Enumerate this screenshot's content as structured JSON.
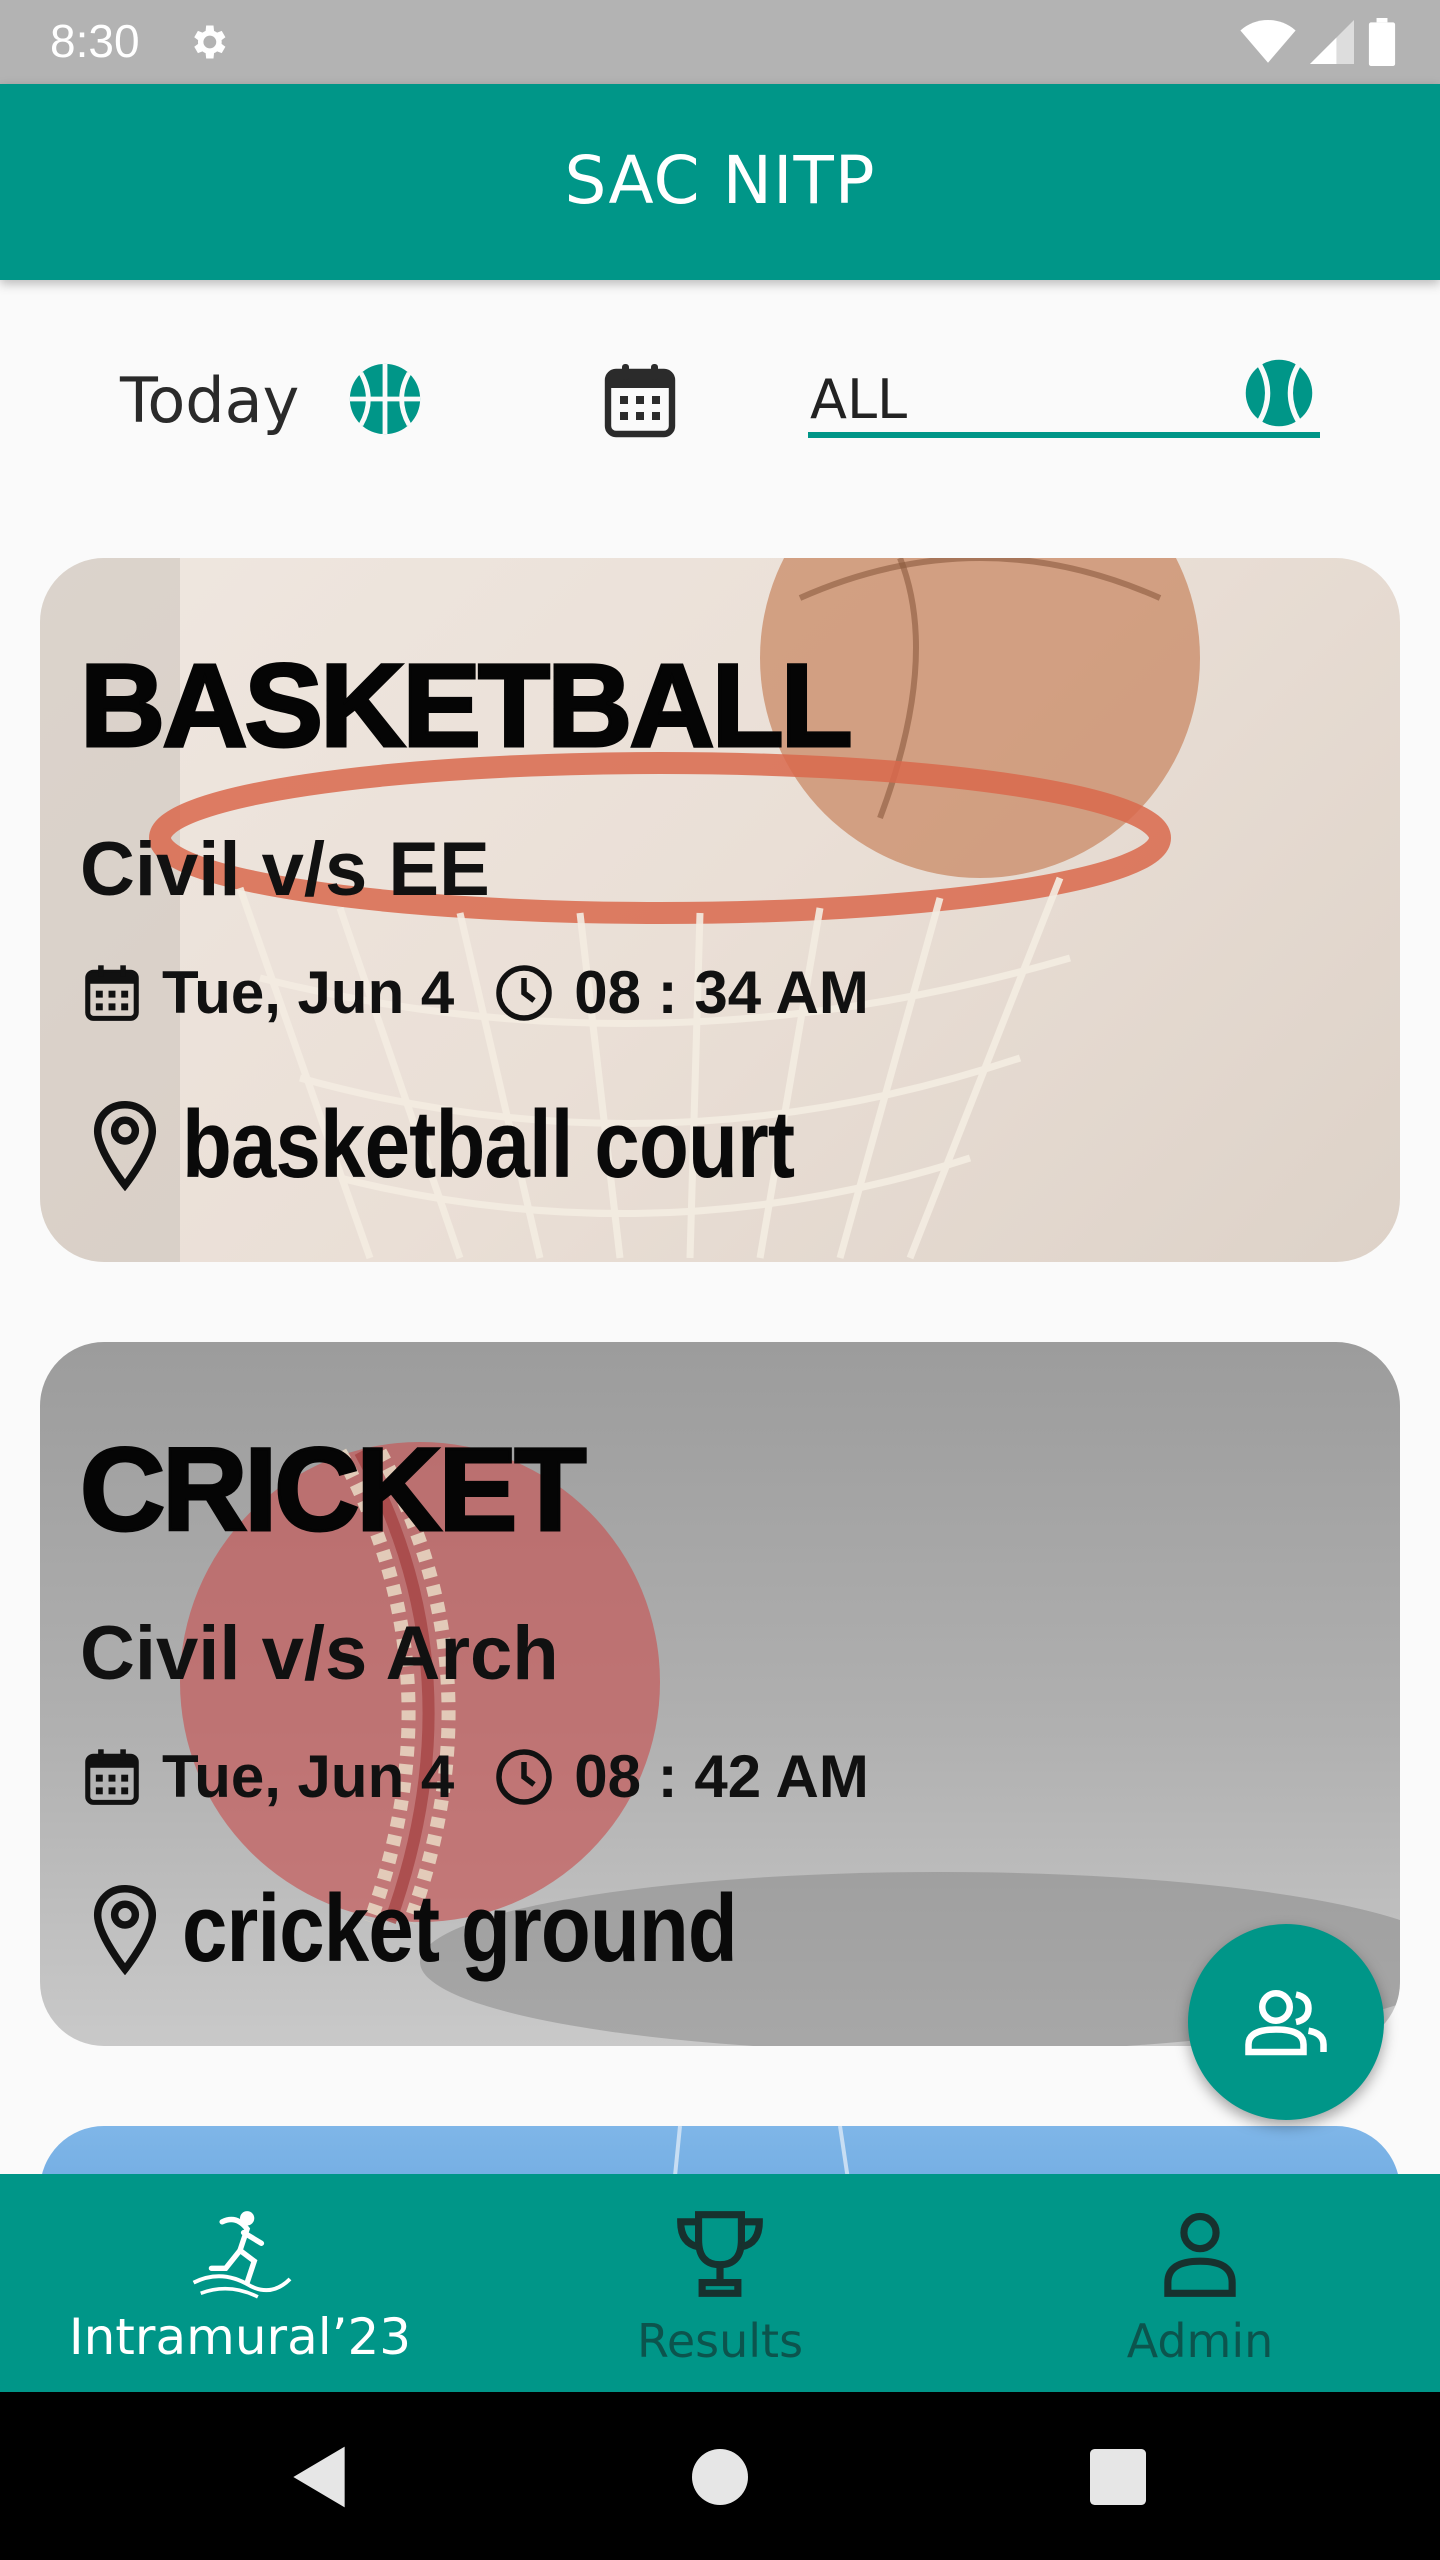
{
  "status_bar": {
    "time": "8:30"
  },
  "app_bar": {
    "title": "SAC NITP"
  },
  "filter": {
    "today_label": "Today",
    "sport_select_value": "ALL"
  },
  "cards": [
    {
      "sport": "BASKETBALL",
      "match": "Civil v/s EE",
      "date": "Tue, Jun 4",
      "time": "08 : 34 AM",
      "venue": "basketball court"
    },
    {
      "sport": "CRICKET",
      "match": "Civil v/s Arch",
      "date": "Tue, Jun 4",
      "time": "08 : 42 AM",
      "venue": "cricket ground"
    }
  ],
  "bottom_nav": [
    {
      "label": "Intramural’23",
      "icon": "runner-logo-icon",
      "active": true
    },
    {
      "label": "Results",
      "icon": "trophy-icon",
      "active": false
    },
    {
      "label": "Admin",
      "icon": "person-icon",
      "active": false
    }
  ],
  "colors": {
    "primary": "#009688",
    "status_bar": "#b3b3b3"
  }
}
